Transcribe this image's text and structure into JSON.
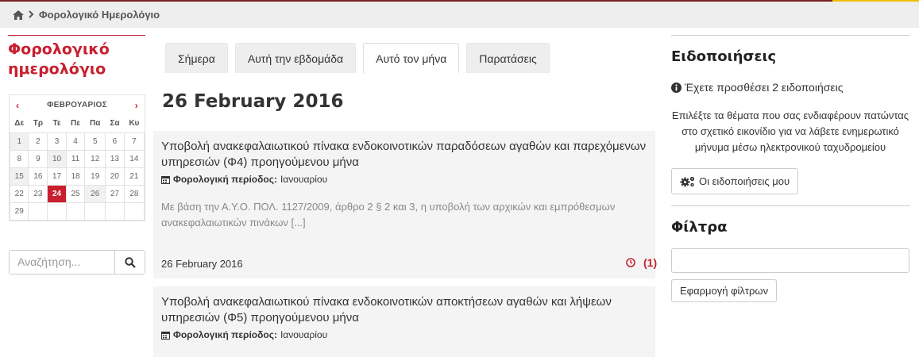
{
  "breadcrumb": {
    "current": "Φορολογικό Ημερολόγιο"
  },
  "sidebar": {
    "title_line1": "Φορολογικό",
    "title_line2": "ημερολόγιο",
    "calendar": {
      "month": "ΦΕΒΡΟΥΑΡΙΟΣ",
      "prev": "‹",
      "next": "›",
      "weekdays": [
        "Δε",
        "Τρ",
        "Τε",
        "Πε",
        "Πα",
        "Σα",
        "Κυ"
      ],
      "weeks": [
        [
          "1",
          "2",
          "3",
          "4",
          "5",
          "6",
          "7"
        ],
        [
          "8",
          "9",
          "10",
          "11",
          "12",
          "13",
          "14"
        ],
        [
          "15",
          "16",
          "17",
          "18",
          "19",
          "20",
          "21"
        ],
        [
          "22",
          "23",
          "24",
          "25",
          "26",
          "27",
          "28"
        ],
        [
          "29",
          "",
          "",
          "",
          "",
          "",
          ""
        ]
      ],
      "selected_day": "24"
    },
    "search": {
      "placeholder": "Αναζήτηση..."
    }
  },
  "tabs": [
    "Σήμερα",
    "Αυτή την εβδομάδα",
    "Αυτό τον μήνα",
    "Παρατάσεις"
  ],
  "active_tab": "Αυτό τον μήνα",
  "main": {
    "date_heading": "26 February 2016",
    "events": [
      {
        "title": "Υποβολή ανακεφαλαιωτικού πίνακα ενδοκοινοτικών παραδόσεων αγαθών και παρεχόμενων υπηρεσιών (Φ4) προηγούμενου μήνα",
        "period_label": "Φορολογική περίοδος:",
        "period_value": "Ιανουαρίου",
        "description": "Με βάση την Α.Υ.Ο. ΠΟΛ. 1127/2009, άρθρο 2 § 2 και 3, η υποβολή των αρχικών και εμπρόθεσμων ανακεφαλαιωτικών πινάκων [...]",
        "date": "26 February 2016",
        "count": "(1)"
      },
      {
        "title": "Υποβολή ανακεφαλαιωτικού πίνακα ενδοκοινοτικών αποκτήσεων αγαθών και λήψεων υπηρεσιών (Φ5) προηγούμενου μήνα",
        "period_label": "Φορολογική περίοδος:",
        "period_value": "Ιανουαρίου"
      }
    ]
  },
  "notifications": {
    "heading": "Ειδοποιήσεις",
    "info": "Έχετε προσθέσει 2 ειδοποιήσεις",
    "help": "Επιλέξτε τα θέματα που σας ενδιαφέρουν πατώντας στο σχετικό εικονίδιο  για να λάβετε ενημερωτικό μήνυμα μέσω ηλεκτρονικού ταχυδρομείου",
    "button": "Οι ειδοποιήσεις μου"
  },
  "filters": {
    "heading": "Φίλτρα",
    "input_value": "",
    "apply_button": "Εφαρμογή φίλτρων"
  },
  "colors": {
    "accent": "#c8202f",
    "card_bg": "#f4f4f4",
    "breadcrumb_bg": "#eeeeee"
  },
  "icons": [
    "home-icon",
    "chevron-right-icon",
    "search-icon",
    "calendar-icon",
    "clock-icon",
    "info-icon",
    "gears-icon"
  ]
}
